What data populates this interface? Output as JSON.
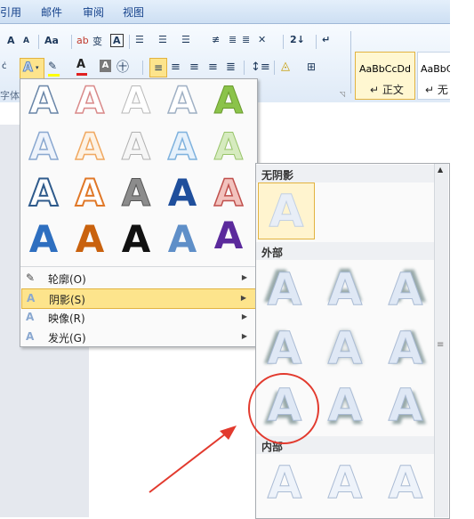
{
  "tabs": [
    "引用",
    "邮件",
    "审阅",
    "视图"
  ],
  "ribbon": {
    "row1": [
      "A",
      "A",
      "Aa",
      "ab",
      "变",
      "A",
      "☰",
      "☰",
      "☰",
      "≢",
      "≣",
      "≣",
      "✕",
      "2↓",
      "↵"
    ],
    "group_label": "字体",
    "styles": [
      {
        "preview": "AaBbCcDd",
        "name": "↵ 正文"
      },
      {
        "preview": "AaBbC",
        "name": "↵ 无"
      }
    ]
  },
  "effects_menu": {
    "items": [
      {
        "label": "轮廓(O)",
        "icon": "outline-icon"
      },
      {
        "label": "阴影(S)",
        "icon": "shadow-icon"
      },
      {
        "label": "映像(R)",
        "icon": "reflection-icon"
      },
      {
        "label": "发光(G)",
        "icon": "glow-icon"
      }
    ],
    "gallery_letter": "A"
  },
  "shadow_menu": {
    "sections": [
      "无阴影",
      "外部",
      "内部"
    ],
    "letter": "A"
  },
  "colors": {
    "highlight": "#fde48c",
    "accent_red": "#e23a2e"
  }
}
